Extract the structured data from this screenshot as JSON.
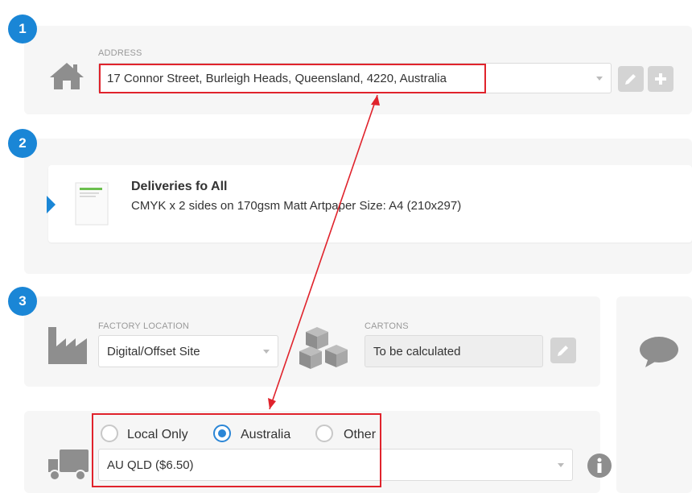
{
  "steps": [
    "1",
    "2",
    "3"
  ],
  "address": {
    "label": "ADDRESS",
    "value": "17 Connor Street, Burleigh Heads, Queensland, 4220, Australia"
  },
  "product": {
    "title": "Deliveries fo All",
    "description": "CMYK x 2 sides on 170gsm Matt Artpaper Size: A4 (210x297)"
  },
  "factory": {
    "label": "FACTORY LOCATION",
    "value": "Digital/Offset Site"
  },
  "cartons": {
    "label": "CARTONS",
    "value": "To be calculated"
  },
  "delivery": {
    "options": [
      "Local Only",
      "Australia",
      "Other"
    ],
    "selected": "Australia",
    "rate": "AU QLD ($6.50)"
  },
  "colors": {
    "accent": "#1a86d6",
    "highlight": "#e0232c",
    "icon": "#8e8e8e"
  }
}
